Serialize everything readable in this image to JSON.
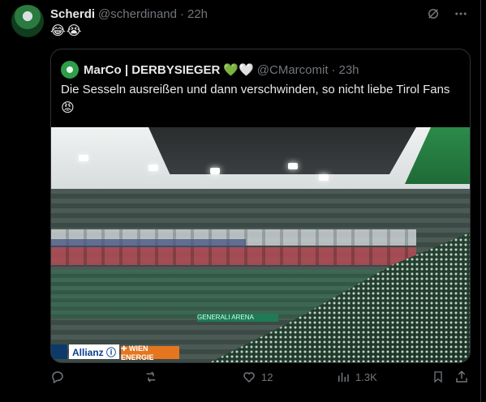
{
  "post": {
    "author_name": "Scherdi",
    "handle": "@scherdinand",
    "dot": "·",
    "time": "22h",
    "emojis": "😂😭"
  },
  "quote": {
    "author_name": "MarCo | DERBYSIEGER",
    "badges": "💚🤍",
    "handle": "@CMarcomit",
    "dot": "·",
    "time": "23h",
    "text": "Die Sesseln ausreißen und dann verschwinden, so nicht liebe Tirol Fans",
    "emoji": "😡",
    "image_signs": {
      "allianz": "Allianz ⓘ",
      "wien_energie": "✚ WIEN ENERGIE",
      "green_banner": "GENERALI  ARENA"
    }
  },
  "actions": {
    "reply_count": "",
    "repost_count": "",
    "like_count": "12",
    "views_count": "1.3K"
  },
  "icons": {
    "top": [
      "grok-icon",
      "more-icon"
    ],
    "actions": [
      "reply-icon",
      "repost-icon",
      "like-icon",
      "views-icon",
      "bookmark-icon",
      "share-icon"
    ]
  }
}
